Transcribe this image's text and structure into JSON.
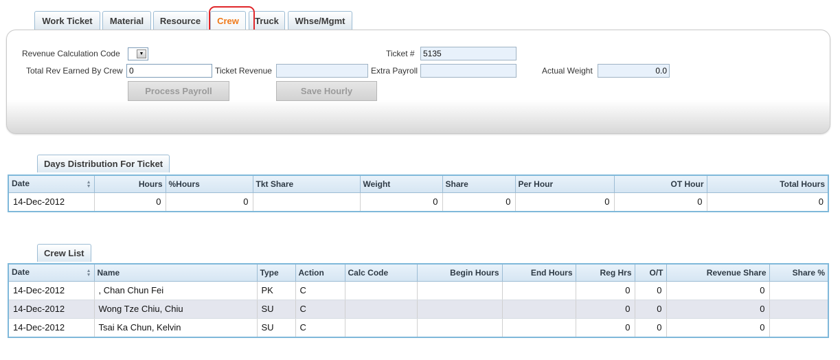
{
  "tabs": [
    "Work Ticket",
    "Material",
    "Resource",
    "Crew",
    "Truck",
    "Whse/Mgmt"
  ],
  "active_tab": "Crew",
  "form": {
    "revenue_calc_code_label": "Revenue Calculation Code",
    "revenue_calc_code_value": "",
    "ticket_no_label": "Ticket #",
    "ticket_no_value": "5135",
    "total_rev_label": "Total Rev Earned By Crew",
    "total_rev_value": "0",
    "ticket_revenue_label": "Ticket Revenue",
    "ticket_revenue_value": "",
    "extra_payroll_label": "Extra Payroll",
    "extra_payroll_value": "",
    "actual_weight_label": "Actual Weight",
    "actual_weight_value": "0.0",
    "process_payroll_label": "Process Payroll",
    "save_hourly_label": "Save Hourly"
  },
  "days_distribution": {
    "title": "Days Distribution For Ticket",
    "columns": [
      "Date",
      "Hours",
      "%Hours",
      "Tkt Share",
      "Weight",
      "Share",
      "Per Hour",
      "OT Hour",
      "Total Hours"
    ],
    "rows": [
      [
        "14-Dec-2012",
        "0",
        "0",
        "",
        "0",
        "0",
        "0",
        "0",
        "0"
      ]
    ]
  },
  "crew_list": {
    "title": "Crew List",
    "columns": [
      "Date",
      "Name",
      "Type",
      "Action",
      "Calc Code",
      "Begin Hours",
      "End Hours",
      "Reg Hrs",
      "O/T",
      "Revenue Share",
      "Share %"
    ],
    "rows": [
      [
        "14-Dec-2012",
        ", Chan Chun Fei",
        "PK",
        "C",
        "",
        "",
        "",
        "0",
        "0",
        "0",
        ""
      ],
      [
        "14-Dec-2012",
        "Wong Tze Chiu, Chiu",
        "SU",
        "C",
        "",
        "",
        "",
        "0",
        "0",
        "0",
        ""
      ],
      [
        "14-Dec-2012",
        "Tsai Ka Chun, Kelvin",
        "SU",
        "C",
        "",
        "",
        "",
        "0",
        "0",
        "0",
        ""
      ]
    ]
  },
  "colors": {
    "active_tab_text": "#f07a1a",
    "highlight_circle": "#e0262a",
    "grid_border": "#7fb8da"
  }
}
